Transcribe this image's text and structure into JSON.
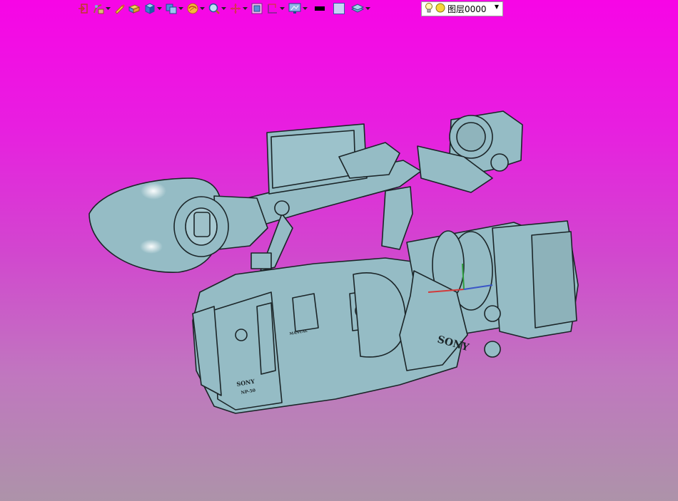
{
  "toolbar": {
    "buttons": [
      {
        "name": "exit-sketch",
        "icon": "exit-icon"
      },
      {
        "name": "display-style",
        "icon": "hand-icon"
      },
      {
        "name": "pencil",
        "icon": "pencil-icon"
      },
      {
        "name": "shaded",
        "icon": "shaded-box-icon"
      },
      {
        "name": "solid",
        "icon": "cube-icon"
      },
      {
        "name": "view-orient",
        "icon": "view-cube-icon"
      },
      {
        "name": "rotate",
        "icon": "rotate-icon"
      },
      {
        "name": "zoom",
        "icon": "zoom-icon"
      },
      {
        "name": "pan",
        "icon": "pan-icon"
      },
      {
        "name": "section",
        "icon": "section-icon"
      },
      {
        "name": "measure",
        "icon": "measure-icon"
      },
      {
        "name": "display",
        "icon": "monitor-icon"
      },
      {
        "name": "line-color",
        "icon": "black-line-swatch"
      },
      {
        "name": "face-color",
        "icon": "color-swatch"
      },
      {
        "name": "layer-tool",
        "icon": "layer-icon"
      }
    ]
  },
  "layer": {
    "name": "图层0000",
    "visible_icon": "lightbulb-icon",
    "state_icon": "yellow-circle-icon"
  },
  "model": {
    "brand_side": "SONY",
    "brand_battery": "SONY",
    "battery_model": "NP-50",
    "manual_label": "MANUAL"
  },
  "colors": {
    "bg_top": "#f705e6",
    "bg_bottom": "#ad93a9",
    "model_fill": "#95bcc5",
    "model_stroke": "#1b2528"
  }
}
